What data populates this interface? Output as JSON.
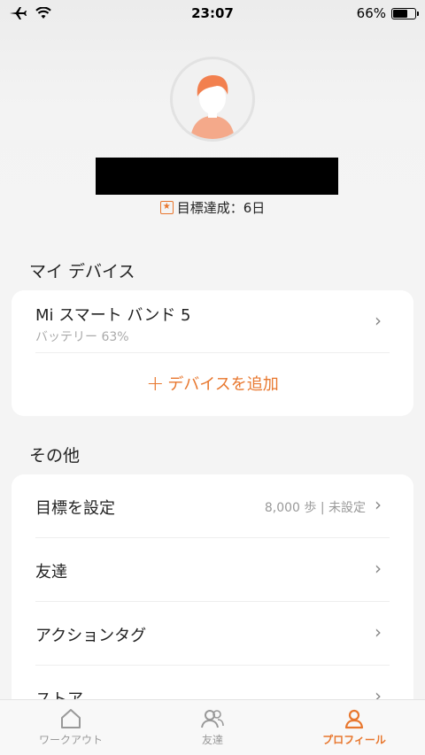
{
  "status_bar": {
    "time": "23:07",
    "battery_percent": "66%",
    "battery_level": 0.66
  },
  "profile": {
    "goal_label": "目標達成：6日"
  },
  "my_devices": {
    "title": "マイ デバイス",
    "device_name": "Mi スマート バンド 5",
    "device_battery": "バッテリー 63%",
    "add_device_label": "デバイスを追加"
  },
  "others": {
    "title": "その他",
    "items": [
      {
        "label": "目標を設定",
        "value": "8,000 歩 | 未設定"
      },
      {
        "label": "友達",
        "value": ""
      },
      {
        "label": "アクションタグ",
        "value": ""
      },
      {
        "label": "ストア",
        "value": ""
      }
    ]
  },
  "bottom_nav": {
    "tabs": [
      {
        "label": "ワークアウト",
        "icon": "home-icon"
      },
      {
        "label": "友達",
        "icon": "friends-icon"
      },
      {
        "label": "プロフィール",
        "icon": "profile-icon"
      }
    ],
    "active_index": 2
  },
  "colors": {
    "accent": "#e8772e",
    "avatar_hair": "#f2804f",
    "avatar_body": "#f4b090"
  }
}
